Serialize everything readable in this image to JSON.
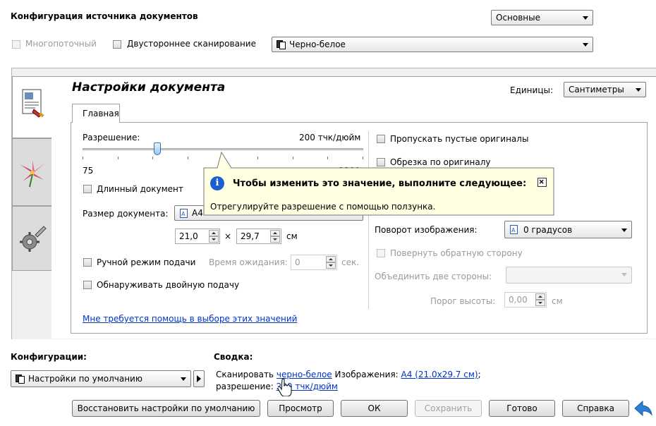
{
  "top": {
    "title": "Конфигурация источника документов",
    "profile_select": "Основные",
    "multistream_label": "Многопоточный",
    "duplex_label": "Двустороннее сканирование",
    "color_mode": "Черно-белое"
  },
  "doc": {
    "heading": "Настройки документа",
    "units_label": "Единицы:",
    "units_value": "Сантиметры",
    "tab_main": "Главная",
    "resolution_label": "Разрешение:",
    "resolution_value": "200 тчк/дюйм",
    "slider_min": "75",
    "slider_max": "1200",
    "slider_level_percent": 26,
    "long_doc_label": "Длинный документ",
    "doc_size_label": "Размер документа:",
    "doc_size_value": "A4",
    "width": "21,0",
    "times": "×",
    "height": "29,7",
    "size_unit": "см",
    "manual_feed_label": "Ручной режим подачи",
    "timeout_label": "Время ожидания:",
    "timeout_value": "0",
    "timeout_unit": "сек.",
    "double_feed_label": "Обнаруживать двойную подачу",
    "help_link": "Мне требуется помощь в выборе этих значений",
    "skip_blank_label": "Пропускать пустые оригиналы",
    "crop_label": "Обрезка по оригиналу",
    "rotation_label": "Поворот изображения:",
    "rotation_value": "0 градусов",
    "rotate_back_label": "Повернуть обратную сторону",
    "merge_label": "Объединить две стороны:",
    "merge_value": "",
    "height_threshold_label": "Порог высоты:",
    "height_threshold_value": "0,00",
    "height_threshold_unit": "см"
  },
  "tooltip": {
    "title": "Чтобы изменить это значение, выполните следующее:",
    "body": "Отрегулируйте разрешение с помощью ползунка."
  },
  "configs": {
    "label": "Конфигурации:",
    "value": "Настройки по умолчанию"
  },
  "summary": {
    "label": "Сводка:",
    "scan_prefix": "Сканировать",
    "scan_mode_link": "черно-белое",
    "images_prefix": "Изображения:",
    "images_link": "A4 (21.0x29.7 см)",
    "images_suffix": ";",
    "res_prefix": "разрешение:",
    "res_link": "200 тчк/дюйм"
  },
  "buttons": {
    "restore": "Восстановить настройки по умолчанию",
    "preview": "Просмотр",
    "ok": "ОК",
    "save": "Сохранить",
    "done": "Готово",
    "help": "Справка"
  },
  "colors": {
    "link": "#0033cc",
    "tooltip_bg": "#ffffe1",
    "info_blue": "#1c5fd1",
    "back_arrow": "#2d7fd6"
  }
}
